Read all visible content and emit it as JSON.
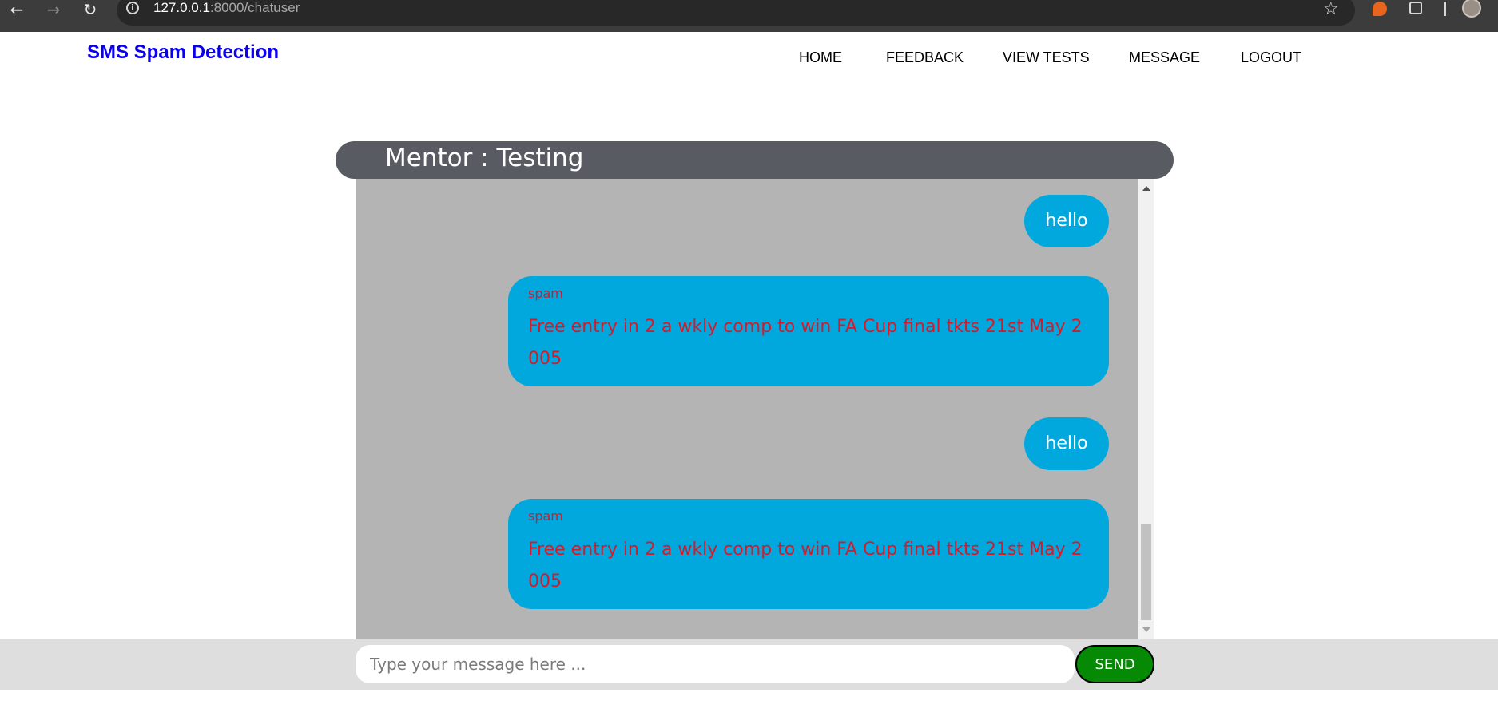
{
  "browser": {
    "url_host": "127.0.0.1",
    "url_path": ":8000/chatuser",
    "icons": [
      "back-arrow-icon",
      "forward-arrow-icon",
      "reload-icon",
      "info-icon",
      "star-icon",
      "extension-icon",
      "puzzle-icon",
      "profile-avatar"
    ]
  },
  "site": {
    "brand": "SMS Spam Detection",
    "brand_color": "#0a00ee",
    "nav": [
      {
        "label": "HOME"
      },
      {
        "label": "FEEDBACK"
      },
      {
        "label": "VIEW TESTS"
      },
      {
        "label": "MESSAGE"
      },
      {
        "label": "LOGOUT"
      }
    ]
  },
  "chat": {
    "title": "Mentor : Testing",
    "bubble_color": "#00a8de",
    "spam_text_color": "#d51a2a",
    "messages": [
      {
        "type": "sent",
        "text": "hello"
      },
      {
        "type": "reply",
        "label": "spam",
        "text": "Free entry in 2 a wkly comp to win FA Cup final tkts 21st May 2005"
      },
      {
        "type": "sent",
        "text": "hello"
      },
      {
        "type": "reply",
        "label": "spam",
        "text": "Free entry in 2 a wkly comp to win FA Cup final tkts 21st May 2005"
      }
    ]
  },
  "composer": {
    "placeholder": "Type your message here ...",
    "send_label": "SEND",
    "send_color": "#068a06"
  }
}
